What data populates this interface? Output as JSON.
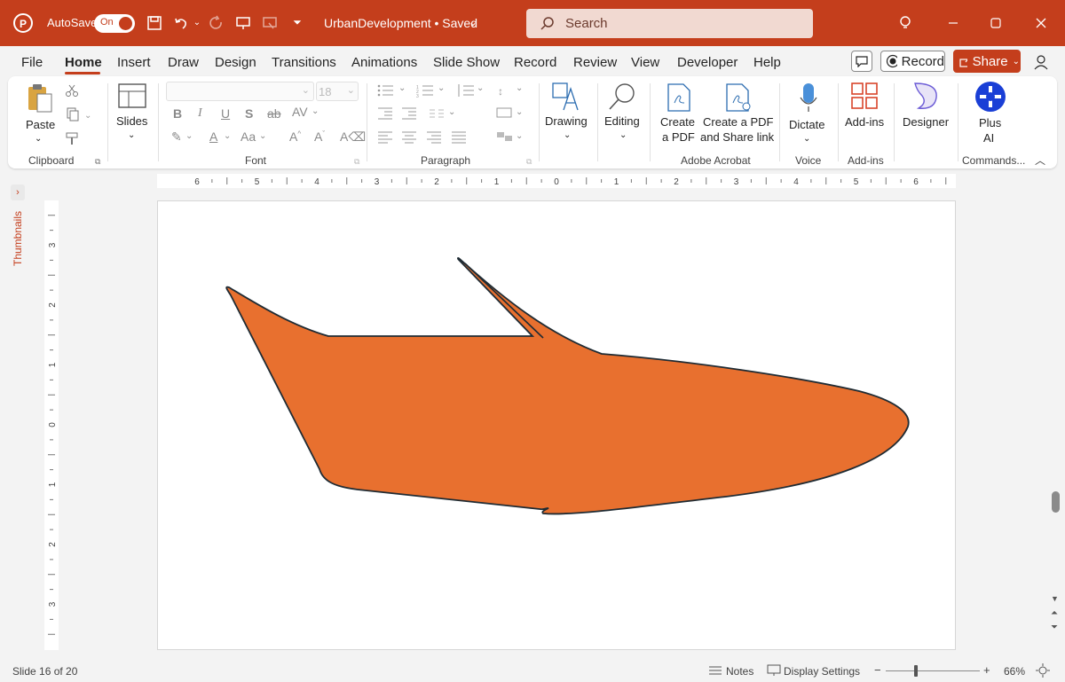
{
  "titlebar": {
    "autosave_label": "AutoSave",
    "autosave_state": "On",
    "doc_title": "UrbanDevelopment • Saved",
    "search_placeholder": "Search"
  },
  "menu": {
    "tabs": [
      "File",
      "Home",
      "Insert",
      "Draw",
      "Design",
      "Transitions",
      "Animations",
      "Slide Show",
      "Record",
      "Review",
      "View",
      "Developer",
      "Help"
    ],
    "active": "Home",
    "record_label": "Record",
    "share_label": "Share"
  },
  "ribbon": {
    "paste": "Paste",
    "slides": "Slides",
    "font_size": "18",
    "drawing": "Drawing",
    "editing": "Editing",
    "create_pdf_1": "Create",
    "create_pdf_2": "a PDF",
    "create_share_1": "Create a PDF",
    "create_share_2": "and Share link",
    "dictate": "Dictate",
    "addins": "Add-ins",
    "designer": "Designer",
    "plus_ai_1": "Plus",
    "plus_ai_2": "AI",
    "groups": {
      "clipboard": "Clipboard",
      "font": "Font",
      "paragraph": "Paragraph",
      "adobe": "Adobe Acrobat",
      "voice": "Voice",
      "addins": "Add-ins",
      "commands": "Commands..."
    }
  },
  "thumbnails_label": "Thumbnails",
  "ruler": {
    "h": [
      "6",
      "5",
      "4",
      "3",
      "2",
      "1",
      "0",
      "1",
      "2",
      "3",
      "4",
      "5",
      "6"
    ],
    "v": [
      "3",
      "2",
      "1",
      "0",
      "1",
      "2",
      "3"
    ]
  },
  "slide_shape": {
    "fill": "#e8702f",
    "stroke": "#1f2b33"
  },
  "status": {
    "slide_info": "Slide 16 of 20",
    "notes": "Notes",
    "display_settings": "Display Settings",
    "zoom": "66%"
  },
  "colors": {
    "accent": "#c43e1c"
  }
}
